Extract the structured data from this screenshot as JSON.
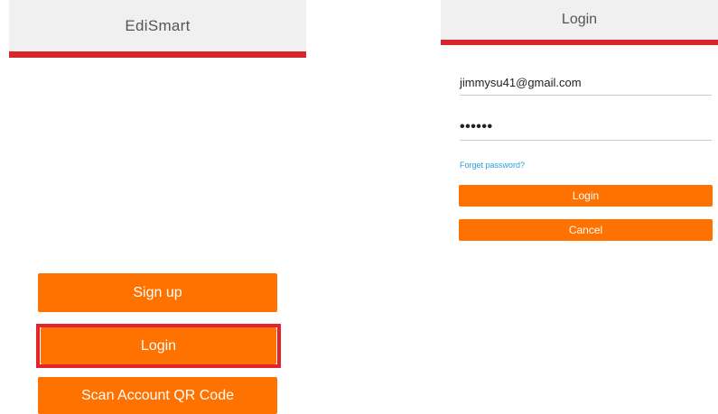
{
  "left_screen": {
    "appbar": {
      "title": "EdiSmart"
    },
    "buttons": {
      "signup_label": "Sign up",
      "login_label": "Login",
      "scan_label": "Scan Account QR Code"
    }
  },
  "right_screen": {
    "appbar": {
      "title": "Login"
    },
    "email": {
      "value": "jimmysu41@gmail.com"
    },
    "password": {
      "value": "••••••"
    },
    "forgot_password_label": "Forget password?",
    "buttons": {
      "login_label": "Login",
      "cancel_label": "Cancel"
    }
  },
  "colors": {
    "accent_orange": "#ff7200",
    "appbar_red": "#d9262c",
    "highlight_red": "#e5232b",
    "link_blue": "#2a9fd6",
    "appbar_bg": "#f0f0f0"
  }
}
